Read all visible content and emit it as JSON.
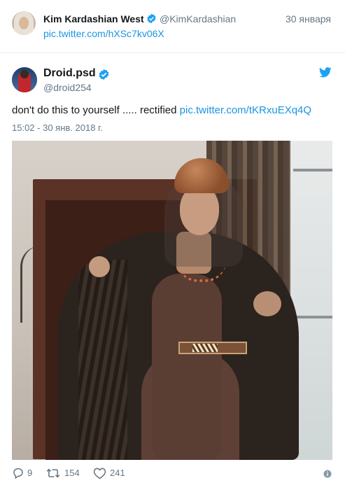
{
  "quoted_tweet": {
    "author_name": "Kim Kardashian West",
    "author_handle": "@KimKardashian",
    "date": "30 января",
    "link": "pic.twitter.com/hXSc7kv06X"
  },
  "tweet": {
    "author_name": "Droid.psd",
    "author_handle": "@droid254",
    "text": "don't do this to yourself ..... rectified ",
    "link": "pic.twitter.com/tKRxuEXq4Q",
    "timestamp": "15:02 - 30 янв. 2018 г."
  },
  "actions": {
    "replies": "9",
    "retweets": "154",
    "likes": "241"
  },
  "icons": {
    "verified": "verified-badge-icon",
    "twitter": "twitter-bird-icon",
    "reply": "reply-icon",
    "retweet": "retweet-icon",
    "like": "heart-icon",
    "info": "info-icon"
  },
  "colors": {
    "link": "#1b95e0",
    "muted": "#657786",
    "text": "#14171a",
    "divider": "#e6ecf0"
  }
}
